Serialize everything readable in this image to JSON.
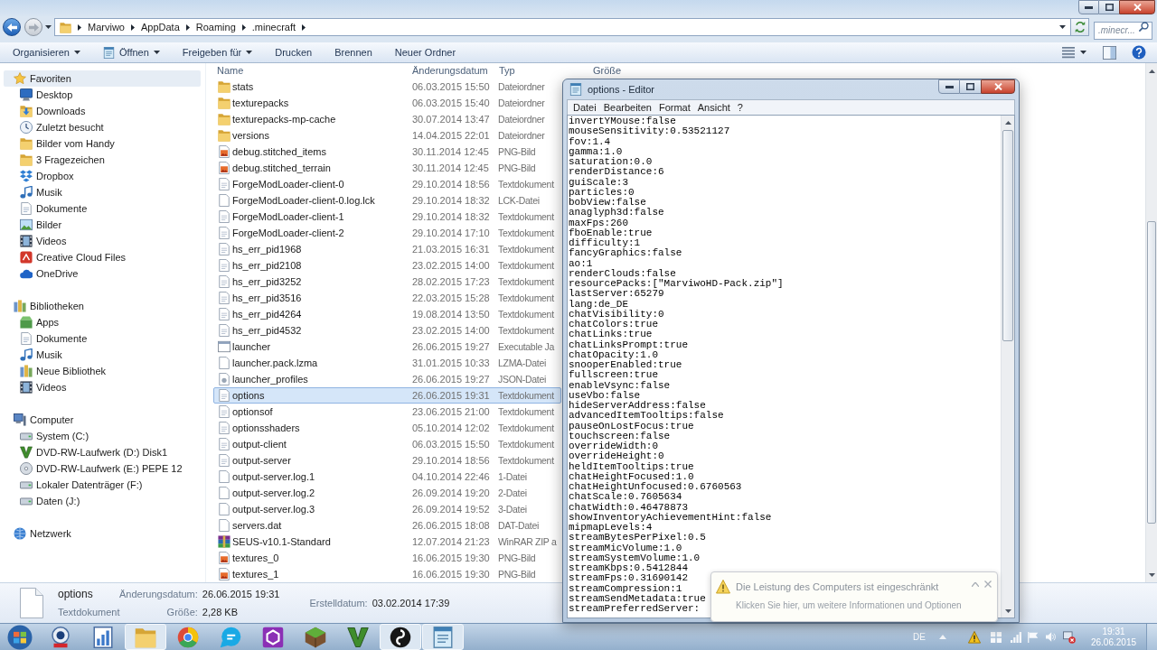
{
  "explorer": {
    "address": {
      "segments": [
        "Marviwo",
        "AppData",
        "Roaming",
        ".minecraft"
      ],
      "search": {
        "placeholder": ".minecr..."
      }
    },
    "toolbar": [
      {
        "label": "Organisieren",
        "kind": "menu"
      },
      {
        "label": "Öffnen",
        "kind": "open-menu"
      },
      {
        "label": "Freigeben für",
        "kind": "menu"
      },
      {
        "label": "Drucken",
        "kind": "action"
      },
      {
        "label": "Brennen",
        "kind": "action"
      },
      {
        "label": "Neuer Ordner",
        "kind": "action"
      }
    ],
    "sidebar": [
      {
        "label": "Favoriten",
        "kind": "favorites",
        "selected": true,
        "children": [
          {
            "label": "Desktop",
            "kind": "desktop"
          },
          {
            "label": "Downloads",
            "kind": "downloads"
          },
          {
            "label": "Zuletzt besucht",
            "kind": "recent"
          },
          {
            "label": "Bilder vom Handy",
            "kind": "folder"
          },
          {
            "label": "3 Fragezeichen",
            "kind": "folder"
          },
          {
            "label": "Dropbox",
            "kind": "sync-folder"
          },
          {
            "label": "Musik",
            "kind": "music"
          },
          {
            "label": "Dokumente",
            "kind": "documents"
          },
          {
            "label": "Bilder",
            "kind": "pictures"
          },
          {
            "label": "Videos",
            "kind": "videos"
          },
          {
            "label": "Creative Cloud Files",
            "kind": "cloud-folder"
          },
          {
            "label": "OneDrive",
            "kind": "cloud-storage"
          }
        ]
      },
      {
        "label": "Bibliotheken",
        "kind": "library",
        "selected": false,
        "children": [
          {
            "label": "Apps",
            "kind": "apps"
          },
          {
            "label": "Dokumente",
            "kind": "documents"
          },
          {
            "label": "Musik",
            "kind": "music"
          },
          {
            "label": "Neue Bibliothek",
            "kind": "library"
          },
          {
            "label": "Videos",
            "kind": "videos"
          }
        ]
      },
      {
        "label": "Computer",
        "kind": "computer",
        "selected": false,
        "children": [
          {
            "label": "System (C:)",
            "kind": "drive"
          },
          {
            "label": "DVD-RW-Laufwerk (D:) Disk1",
            "kind": "dvd-game"
          },
          {
            "label": "DVD-RW-Laufwerk (E:) PEPE 12",
            "kind": "dvd-drive"
          },
          {
            "label": "Lokaler Datenträger (F:)",
            "kind": "drive"
          },
          {
            "label": "Daten (J:)",
            "kind": "drive"
          }
        ]
      },
      {
        "label": "Netzwerk",
        "kind": "network",
        "selected": false
      }
    ],
    "columns": [
      "Name",
      "Änderungsdatum",
      "Typ",
      "Größe"
    ],
    "rows": [
      {
        "name": "stats",
        "modified": "06.03.2015 15:50",
        "type": "Dateiordner",
        "kind": "folder",
        "selected": false
      },
      {
        "name": "texturepacks",
        "modified": "06.03.2015 15:40",
        "type": "Dateiordner",
        "kind": "folder",
        "selected": false
      },
      {
        "name": "texturepacks-mp-cache",
        "modified": "30.07.2014 13:47",
        "type": "Dateiordner",
        "kind": "folder",
        "selected": false
      },
      {
        "name": "versions",
        "modified": "14.04.2015 22:01",
        "type": "Dateiordner",
        "kind": "folder",
        "selected": false
      },
      {
        "name": "debug.stitched_items",
        "modified": "30.11.2014 12:45",
        "type": "PNG-Bild",
        "kind": "image",
        "selected": false
      },
      {
        "name": "debug.stitched_terrain",
        "modified": "30.11.2014 12:45",
        "type": "PNG-Bild",
        "kind": "image",
        "selected": false
      },
      {
        "name": "ForgeModLoader-client-0",
        "modified": "29.10.2014 18:56",
        "type": "Textdokument",
        "kind": "text",
        "selected": false
      },
      {
        "name": "ForgeModLoader-client-0.log.lck",
        "modified": "29.10.2014 18:32",
        "type": "LCK-Datei",
        "kind": "file",
        "selected": false
      },
      {
        "name": "ForgeModLoader-client-1",
        "modified": "29.10.2014 18:32",
        "type": "Textdokument",
        "kind": "text",
        "selected": false
      },
      {
        "name": "ForgeModLoader-client-2",
        "modified": "29.10.2014 17:10",
        "type": "Textdokument",
        "kind": "text",
        "selected": false
      },
      {
        "name": "hs_err_pid1968",
        "modified": "21.03.2015 16:31",
        "type": "Textdokument",
        "kind": "text",
        "selected": false
      },
      {
        "name": "hs_err_pid2108",
        "modified": "23.02.2015 14:00",
        "type": "Textdokument",
        "kind": "text",
        "selected": false
      },
      {
        "name": "hs_err_pid3252",
        "modified": "28.02.2015 17:23",
        "type": "Textdokument",
        "kind": "text",
        "selected": false
      },
      {
        "name": "hs_err_pid3516",
        "modified": "22.03.2015 15:28",
        "type": "Textdokument",
        "kind": "text",
        "selected": false
      },
      {
        "name": "hs_err_pid4264",
        "modified": "19.08.2014 13:50",
        "type": "Textdokument",
        "kind": "text",
        "selected": false
      },
      {
        "name": "hs_err_pid4532",
        "modified": "23.02.2015 14:00",
        "type": "Textdokument",
        "kind": "text",
        "selected": false
      },
      {
        "name": "launcher",
        "modified": "26.06.2015 19:27",
        "type": "Executable Ja",
        "kind": "program",
        "selected": false
      },
      {
        "name": "launcher.pack.lzma",
        "modified": "31.01.2015 10:33",
        "type": "LZMA-Datei",
        "kind": "file",
        "selected": false
      },
      {
        "name": "launcher_profiles",
        "modified": "26.06.2015 19:27",
        "type": "JSON-Datei",
        "kind": "json",
        "selected": false
      },
      {
        "name": "options",
        "modified": "26.06.2015 19:31",
        "type": "Textdokument",
        "kind": "text",
        "selected": true
      },
      {
        "name": "optionsof",
        "modified": "23.06.2015 21:00",
        "type": "Textdokument",
        "kind": "text",
        "selected": false
      },
      {
        "name": "optionsshaders",
        "modified": "05.10.2014 12:02",
        "type": "Textdokument",
        "kind": "text",
        "selected": false
      },
      {
        "name": "output-client",
        "modified": "06.03.2015 15:50",
        "type": "Textdokument",
        "kind": "text",
        "selected": false
      },
      {
        "name": "output-server",
        "modified": "29.10.2014 18:56",
        "type": "Textdokument",
        "kind": "text",
        "selected": false
      },
      {
        "name": "output-server.log.1",
        "modified": "04.10.2014 22:46",
        "type": "1-Datei",
        "kind": "file",
        "selected": false
      },
      {
        "name": "output-server.log.2",
        "modified": "26.09.2014 19:20",
        "type": "2-Datei",
        "kind": "file",
        "selected": false
      },
      {
        "name": "output-server.log.3",
        "modified": "26.09.2014 19:52",
        "type": "3-Datei",
        "kind": "file",
        "selected": false
      },
      {
        "name": "servers.dat",
        "modified": "26.06.2015 18:08",
        "type": "DAT-Datei",
        "kind": "file",
        "selected": false
      },
      {
        "name": "SEUS-v10.1-Standard",
        "modified": "12.07.2014 21:23",
        "type": "WinRAR ZIP a",
        "kind": "archive",
        "selected": false
      },
      {
        "name": "textures_0",
        "modified": "16.06.2015 19:30",
        "type": "PNG-Bild",
        "kind": "image",
        "selected": false
      },
      {
        "name": "textures_1",
        "modified": "16.06.2015 19:30",
        "type": "PNG-Bild",
        "kind": "image",
        "selected": false
      }
    ],
    "details": {
      "name": "options",
      "type": "Textdokument",
      "columns": [
        [
          {
            "label": "Änderungsdatum:",
            "value": "26.06.2015 19:31"
          },
          {
            "label": "Größe:",
            "value": "2,28 KB"
          }
        ],
        [
          {
            "label": "Erstelldatum:",
            "value": "03.02.2014 17:39"
          }
        ]
      ]
    }
  },
  "editor": {
    "title": "options - Editor",
    "menu": [
      "Datei",
      "Bearbeiten",
      "Format",
      "Ansicht",
      "?"
    ],
    "lines": [
      "invertYMouse:false",
      "mouseSensitivity:0.53521127",
      "fov:1.4",
      "gamma:1.0",
      "saturation:0.0",
      "renderDistance:6",
      "guiScale:3",
      "particles:0",
      "bobView:false",
      "anaglyph3d:false",
      "maxFps:260",
      "fboEnable:true",
      "difficulty:1",
      "fancyGraphics:false",
      "ao:1",
      "renderClouds:false",
      "resourcePacks:[\"MarviwoHD-Pack.zip\"]",
      "lastServer:65279",
      "lang:de_DE",
      "chatVisibility:0",
      "chatColors:true",
      "chatLinks:true",
      "chatLinksPrompt:true",
      "chatOpacity:1.0",
      "snooperEnabled:true",
      "fullscreen:true",
      "enableVsync:false",
      "useVbo:false",
      "hideServerAddress:false",
      "advancedItemTooltips:false",
      "pauseOnLostFocus:true",
      "touchscreen:false",
      "overrideWidth:0",
      "overrideHeight:0",
      "heldItemTooltips:true",
      "chatHeightFocused:1.0",
      "chatHeightUnfocused:0.6760563",
      "chatScale:0.7605634",
      "chatWidth:0.46478873",
      "showInventoryAchievementHint:false",
      "mipmapLevels:4",
      "streamBytesPerPixel:0.5",
      "streamMicVolume:1.0",
      "streamSystemVolume:1.0",
      "streamKbps:0.5412844",
      "streamFps:0.31690142",
      "streamCompression:1",
      "streamSendMetadata:true",
      "streamPreferredServer:"
    ]
  },
  "notification": {
    "title": "Die Leistung des Computers ist eingeschränkt",
    "message": "Klicken Sie hier, um weitere Informationen und Optionen"
  },
  "taskbar": {
    "apps": [
      {
        "kind": "webcam",
        "active": false
      },
      {
        "kind": "document",
        "active": false
      },
      {
        "kind": "explorer",
        "active": true
      },
      {
        "kind": "browser",
        "active": false
      },
      {
        "kind": "chat",
        "active": false
      },
      {
        "kind": "hex-app",
        "active": false
      },
      {
        "kind": "game",
        "active": false
      },
      {
        "kind": "v-app",
        "active": false
      },
      {
        "kind": "recorder",
        "active": true
      },
      {
        "kind": "notepad",
        "active": true
      }
    ],
    "tray": {
      "language": "DE",
      "time": "19:31",
      "date": "26.06.2015"
    }
  }
}
